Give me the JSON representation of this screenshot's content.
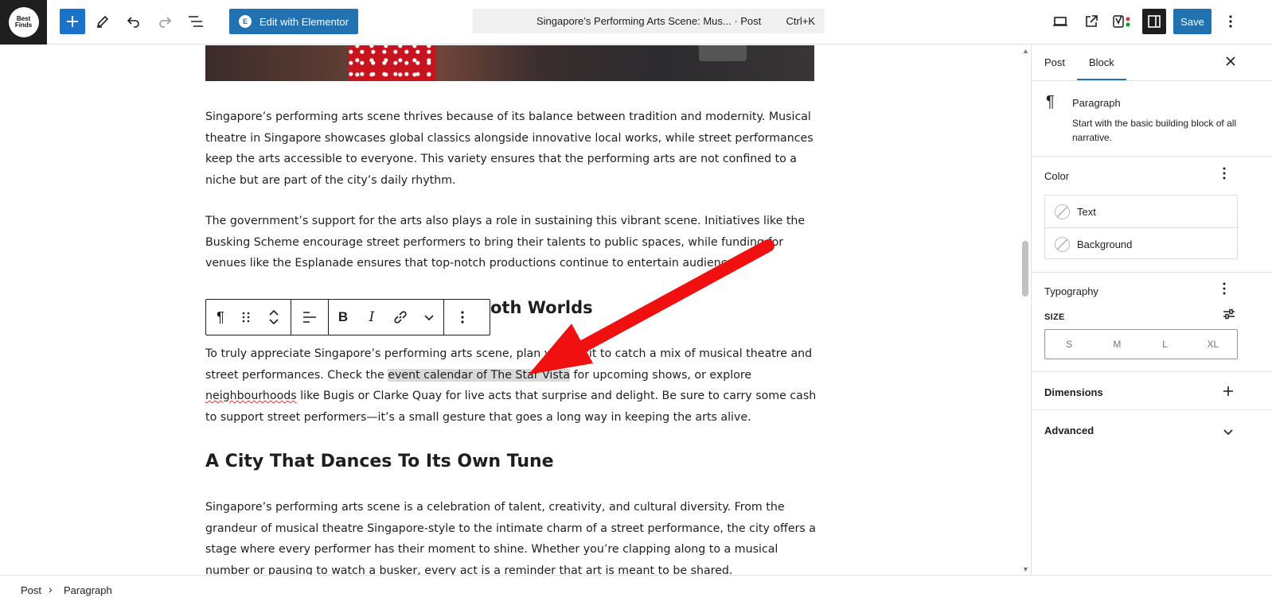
{
  "topbar": {
    "logo_text": "Best Finds",
    "elementor_label": "Edit with Elementor",
    "command_title": "Singapore’s Performing Arts Scene: Mus... · Post",
    "command_shortcut": "Ctrl+K",
    "save_label": "Save"
  },
  "content": {
    "p1": "Singapore’s performing arts scene thrives because of its balance between tradition and modernity. Musical theatre in Singapore showcases global classics alongside innovative local works, while street performances keep the arts accessible to everyone. This variety ensures that the performing arts are not confined to a niche but are part of the city’s daily rhythm.",
    "p2": "The government’s support for the arts also plays a role in sustaining this vibrant scene. Initiatives like the Busking Scheme encourage street performers to bring their talents to public spaces, while funding for venues like the Esplanade ensures that top-notch productions continue to entertain audiences.",
    "h1_visible": "oth Worlds",
    "p3_a": "To truly appreciate Singapore’s performing arts scene, plan your visit to catch a mix of musical theatre and street performances. Check the ",
    "p3_link": "event calendar of The Star Vista",
    "p3_b": " for upcoming shows, or explore ",
    "p3_misspelled": "neighbourhoods",
    "p3_c": " like Bugis or Clarke Quay for live acts that surprise and delight. Be sure to carry some cash to support street performers—it’s a small gesture that goes a long way in keeping the arts alive.",
    "h2": "A City That Dances To Its Own Tune",
    "p4": "Singapore’s performing arts scene is a celebration of talent, creativity, and cultural diversity. From the grandeur of musical theatre Singapore-style to the intimate charm of a street performance, the city offers a stage where every performer has their moment to shine. Whether you’re clapping along to a musical number or pausing to watch a busker, every act is a reminder that art is meant to be shared."
  },
  "block_toolbar": {
    "paragraph_icon": "¶",
    "bold": "B",
    "italic": "I"
  },
  "sidebar": {
    "tabs": [
      {
        "label": "Post"
      },
      {
        "label": "Block"
      }
    ],
    "active_tab": "Block",
    "block_name": "Paragraph",
    "block_desc": "Start with the basic building block of all narrative.",
    "color_title": "Color",
    "color_text": "Text",
    "color_background": "Background",
    "typography_title": "Typography",
    "size_label": "SIZE",
    "size_options": [
      "S",
      "M",
      "L",
      "XL"
    ],
    "dimensions_title": "Dimensions",
    "advanced_title": "Advanced"
  },
  "breadcrumb": {
    "root": "Post",
    "current": "Paragraph"
  },
  "colors": {
    "primary": "#2271b1",
    "annotation_arrow": "#f01010",
    "highlight": "#d9d9d9"
  }
}
